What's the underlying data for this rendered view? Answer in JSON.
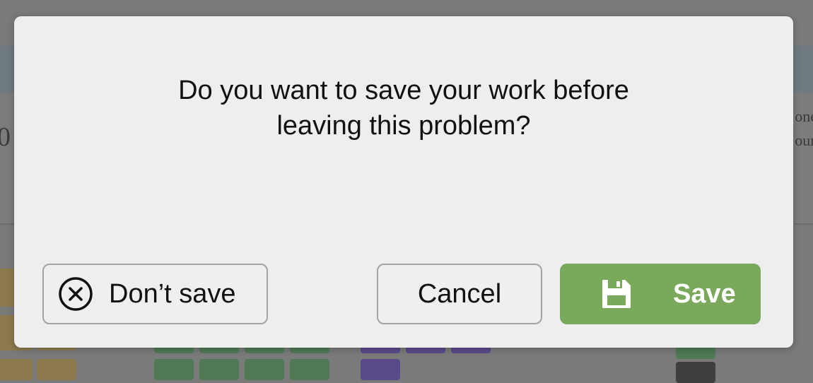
{
  "background": {
    "left_fragment": "0",
    "right_fragments": [
      "one",
      "our"
    ]
  },
  "dialog": {
    "message": "Do you want to save your work before leaving this problem?",
    "buttons": {
      "dont_save": {
        "label": "Don’t save",
        "icon": "circle-x-icon"
      },
      "cancel": {
        "label": "Cancel"
      },
      "save": {
        "label": "Save",
        "icon": "floppy-disk-icon",
        "color": "#7aa95c"
      }
    }
  }
}
